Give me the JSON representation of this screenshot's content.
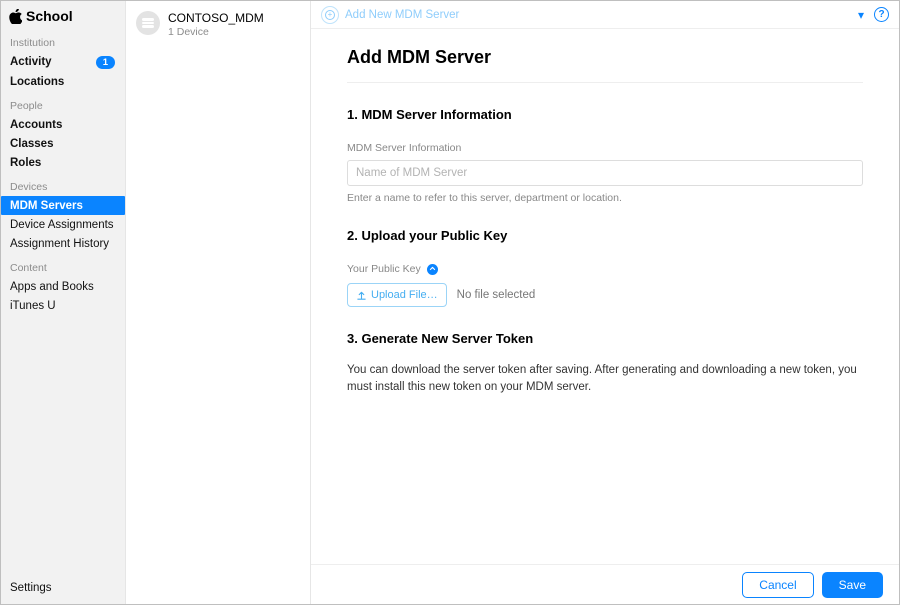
{
  "brand": "School",
  "sidebar": {
    "sections": [
      {
        "heading": "Institution",
        "items": [
          {
            "label": "Activity",
            "bold": true,
            "badge": "1"
          },
          {
            "label": "Locations",
            "bold": true
          }
        ]
      },
      {
        "heading": "People",
        "items": [
          {
            "label": "Accounts",
            "bold": true
          },
          {
            "label": "Classes",
            "bold": true
          },
          {
            "label": "Roles",
            "bold": true
          }
        ]
      },
      {
        "heading": "Devices",
        "items": [
          {
            "label": "MDM Servers",
            "bold": true,
            "active": true
          },
          {
            "label": "Device Assignments"
          },
          {
            "label": "Assignment History"
          }
        ]
      },
      {
        "heading": "Content",
        "items": [
          {
            "label": "Apps and Books"
          },
          {
            "label": "iTunes U"
          }
        ]
      }
    ],
    "footer": "Settings"
  },
  "mid_list": {
    "items": [
      {
        "title": "CONTOSO_MDM",
        "subtitle": "1 Device"
      }
    ]
  },
  "crumb": {
    "title": "Add New MDM Server"
  },
  "main": {
    "page_title": "Add MDM Server",
    "section1": {
      "title": "1. MDM Server Information",
      "field_label": "MDM Server Information",
      "placeholder": "Name of MDM Server",
      "help": "Enter a name to refer to this server, department or location."
    },
    "section2": {
      "title": "2. Upload your Public Key",
      "label": "Your Public Key",
      "upload_label": "Upload File…",
      "no_file": "No file selected"
    },
    "section3": {
      "title": "3. Generate New Server Token",
      "text": "You can download the server token after saving. After generating and downloading a new token, you must install this new token on your MDM server."
    }
  },
  "footer": {
    "cancel": "Cancel",
    "save": "Save"
  }
}
